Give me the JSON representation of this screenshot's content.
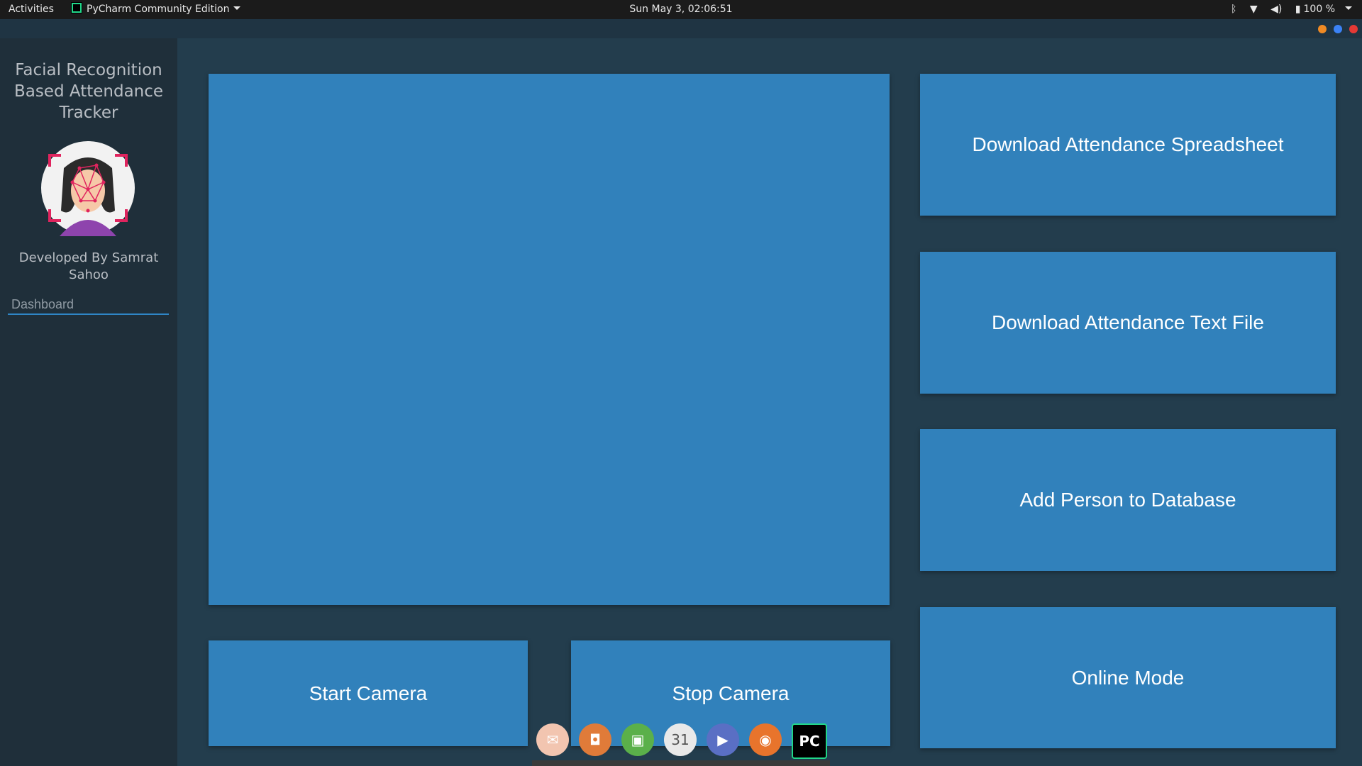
{
  "topbar": {
    "activities": "Activities",
    "app_menu": "PyCharm Community Edition",
    "clock": "Sun May  3, 02:06:51",
    "battery": "100 %"
  },
  "sidebar": {
    "title": "Facial Recognition Based Attendance Tracker",
    "developer": "Developed By Samrat Sahoo",
    "nav": [
      {
        "label": "Dashboard"
      }
    ]
  },
  "main": {
    "buttons": {
      "download_spreadsheet": "Download Attendance Spreadsheet",
      "download_text": "Download Attendance Text File",
      "add_person": "Add Person to Database",
      "online_mode": "Online Mode",
      "start_camera": "Start Camera",
      "stop_camera": "Stop Camera"
    }
  },
  "dock": {
    "items": [
      {
        "name": "mail-icon",
        "glyph": "✉",
        "color": "#f2c5b0"
      },
      {
        "name": "speaker-icon",
        "glyph": "◘",
        "color": "#e07b39"
      },
      {
        "name": "image-viewer-icon",
        "glyph": "▣",
        "color": "#5bb04a"
      },
      {
        "name": "calendar-icon",
        "glyph": "31",
        "color": "#e9e9e9"
      },
      {
        "name": "video-player-icon",
        "glyph": "▶",
        "color": "#5a6fc4"
      },
      {
        "name": "firefox-icon",
        "glyph": "◉",
        "color": "#e8742c"
      },
      {
        "name": "pycharm-icon",
        "glyph": "PC",
        "color": "#000000"
      }
    ]
  },
  "colors": {
    "accent": "#3181bb",
    "background": "#233d4d",
    "sidebar": "#1f2f3a"
  }
}
